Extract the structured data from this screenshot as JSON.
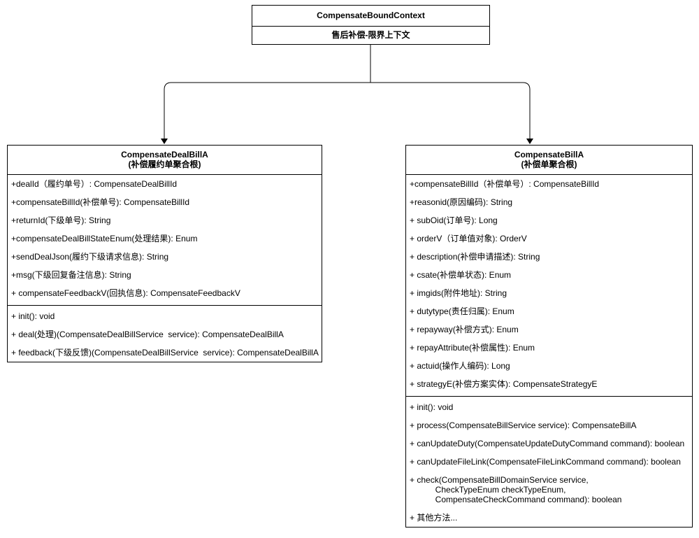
{
  "context": {
    "title": "CompensateBoundContext",
    "subtitle": "售后补偿-限界上下文"
  },
  "deal_bill": {
    "title": "CompensateDealBillA",
    "subtitle": "(补偿履约单聚合根)",
    "attributes": [
      "+dealId（履约单号）: CompensateDealBillId",
      "+compensateBillId(补偿单号): CompensateBillId",
      "+returnId(下级单号): String",
      "+compensateDealBillStateEnum(处理结果): Enum",
      "+sendDealJson(履约下级请求信息): String",
      "+msg(下级回复备注信息): String",
      "+ compensateFeedbackV(回执信息): CompensateFeedbackV"
    ],
    "methods": [
      "+ init(): void",
      "+ deal(处理)(CompensateDealBillService  service): CompensateDealBillA",
      "+ feedback(下级反馈)(CompensateDealBillService  service): CompensateDealBillA"
    ]
  },
  "bill": {
    "title": "CompensateBillA",
    "subtitle": "(补偿单聚合根)",
    "attributes": [
      "+compensateBillId（补偿单号）: CompensateBillId",
      "+reasonid(原因编码): String",
      "+ subOid(订单号): Long",
      "+ orderV（订单值对象): OrderV",
      "+ description(补偿申请描述): String",
      "+ csate(补偿单状态): Enum",
      "+ imgids(附件地址): String",
      "+ dutytype(责任归属): Enum",
      "+ repayway(补偿方式): Enum",
      "+ repayAttribute(补偿属性): Enum",
      "+ actuid(操作人编码): Long",
      "+ strategyE(补偿方案实体): CompensateStrategyE"
    ],
    "methods": [
      "+ init(): void",
      "+ process(CompensateBillService service): CompensateBillA",
      "+ canUpdateDuty(CompensateUpdateDutyCommand command): boolean",
      "+ canUpdateFileLink(CompensateFileLinkCommand command): boolean",
      "+ check(CompensateBillDomainService service,\n           CheckTypeEnum checkTypeEnum,\n           CompensateCheckCommand command): boolean",
      "+ 其他方法..."
    ]
  }
}
